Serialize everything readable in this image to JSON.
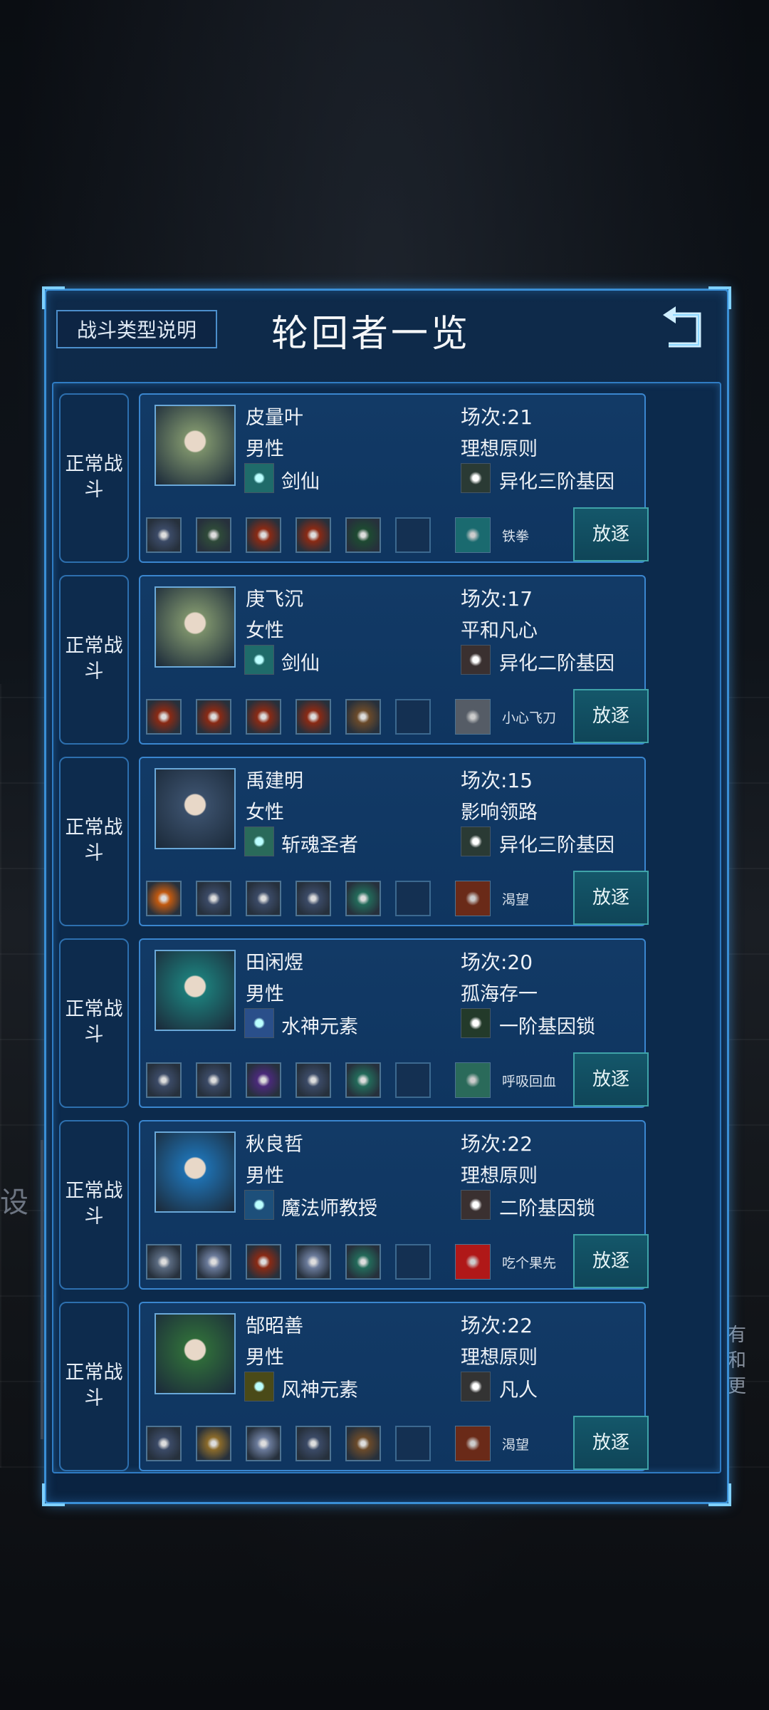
{
  "panel": {
    "help_button": "战斗类型说明",
    "title": "轮回者一览"
  },
  "background": {
    "left_text": "设",
    "right_text": "有和更"
  },
  "characters": [
    {
      "battle_type": "正常战斗",
      "name": "皮量叶",
      "gender": "男性",
      "skill": "剑仙",
      "count": "场次:21",
      "ideal": "理想原则",
      "gene": "异化三阶基因",
      "relic": "铁拳",
      "action": "放逐",
      "colors": {
        "portrait": "#7a8f6a",
        "skill": "#1f6b6a",
        "gene": "#2a3a34",
        "relic": "#1a6a6f"
      },
      "slots": [
        "gem",
        "boots",
        "claw",
        "claw",
        "blade",
        "empty"
      ]
    },
    {
      "battle_type": "正常战斗",
      "name": "庚飞沉",
      "gender": "女性",
      "skill": "剑仙",
      "count": "场次:17",
      "ideal": "平和凡心",
      "gene": "异化二阶基因",
      "relic": "小心飞刀",
      "action": "放逐",
      "colors": {
        "portrait": "#7a8f6a",
        "skill": "#1f6b6a",
        "gene": "#3a3030",
        "relic": "#555c66"
      },
      "slots": [
        "claw",
        "claw",
        "claw",
        "claw",
        "bow",
        "empty"
      ]
    },
    {
      "battle_type": "正常战斗",
      "name": "禹建明",
      "gender": "女性",
      "skill": "斩魂圣者",
      "count": "场次:15",
      "ideal": "影响领路",
      "gene": "异化三阶基因",
      "relic": "渴望",
      "action": "放逐",
      "colors": {
        "portrait": "#3a4f6a",
        "skill": "#2a6a5a",
        "gene": "#2a3a34",
        "relic": "#6a2a18"
      },
      "slots": [
        "amulet",
        "gem",
        "gem",
        "gem",
        "sword",
        "empty"
      ]
    },
    {
      "battle_type": "正常战斗",
      "name": "田闲煜",
      "gender": "男性",
      "skill": "水神元素",
      "count": "场次:20",
      "ideal": "孤海存一",
      "gene": "一阶基因锁",
      "relic": "呼吸回血",
      "action": "放逐",
      "colors": {
        "portrait": "#1d7a78",
        "skill": "#2a4f8a",
        "gene": "#233a2a",
        "relic": "#2a6a5a"
      },
      "slots": [
        "gem",
        "gem",
        "orb",
        "gem",
        "sword",
        "empty"
      ]
    },
    {
      "battle_type": "正常战斗",
      "name": "秋良哲",
      "gender": "男性",
      "skill": "魔法师教授",
      "count": "场次:22",
      "ideal": "理想原则",
      "gene": "二阶基因锁",
      "relic": "吃个果先",
      "action": "放逐",
      "colors": {
        "portrait": "#1f6fae",
        "skill": "#1d4f7a",
        "gene": "#3a3030",
        "relic": "#b01818"
      },
      "slots": [
        "ring",
        "rings",
        "claw",
        "rings",
        "sword",
        "empty"
      ]
    },
    {
      "battle_type": "正常战斗",
      "name": "郜昭善",
      "gender": "男性",
      "skill": "风神元素",
      "count": "场次:22",
      "ideal": "理想原则",
      "gene": "凡人",
      "relic": "渴望",
      "action": "放逐",
      "colors": {
        "portrait": "#2f6a3a",
        "skill": "#4a4a18",
        "gene": "#333",
        "relic": "#6a2a18"
      },
      "slots": [
        "gem",
        "armor",
        "rings",
        "gem",
        "bow",
        "empty"
      ]
    }
  ],
  "slot_colors": {
    "gem": "#3b4a66",
    "boots": "#2f4a3a",
    "claw": "#8a2a14",
    "blade": "#1e4a32",
    "bow": "#6a4a2a",
    "amulet": "#c25a10",
    "sword": "#236a5a",
    "orb": "#4a2a7a",
    "ring": "#5a6a80",
    "rings": "#6a7a9a",
    "armor": "#8a6a2a",
    "empty": "#143052"
  }
}
